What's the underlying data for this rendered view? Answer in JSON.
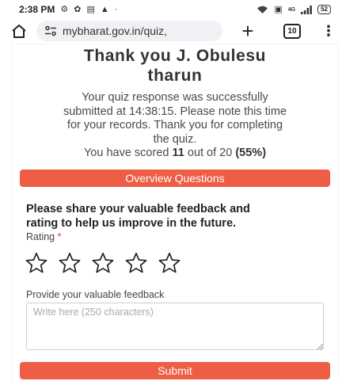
{
  "status_bar": {
    "time": "2:38 PM",
    "signal_text": "4G",
    "battery": "52"
  },
  "browser": {
    "url": "mybharat.gov.in/quiz,",
    "tab_count": "10"
  },
  "page": {
    "title_line1": "Thank you J. Obulesu",
    "title_line2": "tharun",
    "message_line1": "Your quiz response was successfully",
    "message_line2": "submitted at 14:38:15. Please note this time",
    "message_line3": "for your records. Thank you for completing",
    "message_line4": "the quiz.",
    "score_prefix": "You have scored",
    "score_value": "11",
    "score_middle": "out of 20",
    "score_percent": "(55%)",
    "overview_button": "Overview Questions",
    "feedback_heading_line1": "Please share your valuable feedback and",
    "feedback_heading_line2": "rating to help us improve in the future.",
    "rating_label": "Rating",
    "required_marker": "*",
    "rating_value": 0,
    "rating_max": 5,
    "feedback_label": "Provide your valuable feedback",
    "feedback_placeholder": "Write here (250 characters)",
    "submit_button": "Submit"
  },
  "colors": {
    "accent": "#ee5e46",
    "required": "#e53935"
  }
}
